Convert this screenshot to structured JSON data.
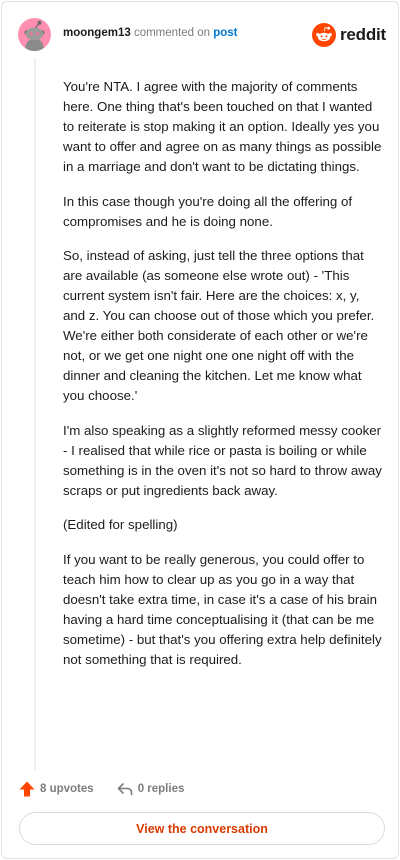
{
  "header": {
    "username": "moongem13",
    "action_text": "commented on",
    "post_link": "post",
    "brand": "reddit"
  },
  "comment": {
    "paragraphs": [
      "You're NTA. I agree with the majority of comments here. One thing that's been touched on that I wanted to reiterate is stop making it an option. Ideally yes you want to offer and agree on as many things as possible in a marriage and don't want to be dictating things.",
      "In this case though you're doing all the offering of compromises and he is doing none.",
      "So, instead of asking, just tell the three options that are available (as someone else wrote out) - 'This current system isn't fair. Here are the choices: x, y, and z. You can choose out of those which you prefer. We're either both considerate of each other or we're not, or we get one night one one night off with the dinner and cleaning the kitchen. Let me know what you choose.'",
      "I'm also speaking as a slightly reformed messy cooker - I realised that while rice or pasta is boiling or while something is in the oven it's not so hard to throw away scraps or put ingredients back away.",
      "(Edited for spelling)",
      "If you want to be really generous, you could offer to teach him how to clear up as you go in a way that doesn't take extra time, in case it's a case of his brain having a hard time conceptualising it (that can be me sometime) - but that's you offering extra help definitely not something that is required."
    ]
  },
  "footer": {
    "upvotes_label": "8 upvotes",
    "replies_label": "0 replies",
    "conversation_button": "View the conversation"
  },
  "icons": {
    "upvote": "upvote-arrow-icon",
    "reply": "reply-arrow-icon",
    "brand": "reddit-snoo-icon",
    "avatar": "snoo-avatar-icon"
  },
  "colors": {
    "accent": "#ff4500",
    "link": "#0079d3",
    "button_text": "#d93a00",
    "avatar_bg": "#ff8eb0"
  }
}
